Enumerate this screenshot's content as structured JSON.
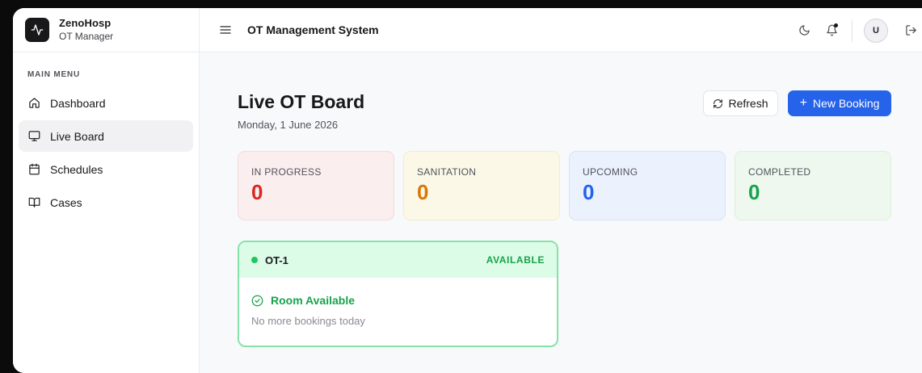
{
  "brand": {
    "name": "ZenoHosp",
    "subtitle": "OT Manager",
    "logo_icon": "activity-icon"
  },
  "sidebar": {
    "section_title": "MAIN MENU",
    "items": [
      {
        "label": "Dashboard",
        "icon": "home-icon",
        "active": false
      },
      {
        "label": "Live Board",
        "icon": "monitor-icon",
        "active": true
      },
      {
        "label": "Schedules",
        "icon": "calendar-icon",
        "active": false
      },
      {
        "label": "Cases",
        "icon": "book-open-icon",
        "active": false
      }
    ]
  },
  "topbar": {
    "title": "OT Management System",
    "icons": [
      "menu-icon",
      "moon-icon",
      "bell-icon",
      "logout-icon"
    ],
    "avatar_initial": "U"
  },
  "page": {
    "title": "Live OT Board",
    "date": "Monday, 1 June 2026",
    "refresh_label": "Refresh",
    "new_booking_label": "New Booking"
  },
  "stats": [
    {
      "label": "IN PROGRESS",
      "value": "0",
      "color": "#dc2626",
      "bg": "#fbeeee",
      "border": "#f6dada"
    },
    {
      "label": "SANITATION",
      "value": "0",
      "color": "#d97706",
      "bg": "#fbf8e7",
      "border": "#f3edcc"
    },
    {
      "label": "UPCOMING",
      "value": "0",
      "color": "#2563eb",
      "bg": "#ebf2fd",
      "border": "#d6e3f8"
    },
    {
      "label": "COMPLETED",
      "value": "0",
      "color": "#16a34a",
      "bg": "#eef8ef",
      "border": "#dcefdf"
    }
  ],
  "ot_room": {
    "name": "OT-1",
    "status": "AVAILABLE",
    "availability_label": "Room Available",
    "note": "No more bookings today"
  },
  "colors": {
    "accent": "#2563eb",
    "available": "#16a34a",
    "sidebar_active": "#f1f1f3"
  }
}
